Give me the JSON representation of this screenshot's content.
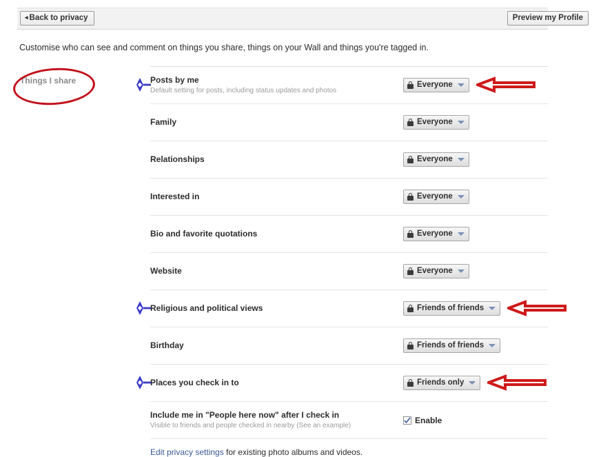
{
  "toolbar": {
    "back_label": "Back to privacy",
    "back_caret": "◂",
    "preview_label": "Preview my Profile"
  },
  "intro": {
    "text": "Customise who can see and comment on things you share, things on your Wall and things you're tagged in."
  },
  "section": {
    "label": "Things I share"
  },
  "icons": {
    "lock": "lock-icon",
    "caret_down": "chevron-down-icon",
    "checkmark": "check-icon",
    "star_marker": "blue-star-marker-icon",
    "red_arrow": "red-arrow-annotation-icon"
  },
  "colors": {
    "annotation_red": "#c2101b",
    "annotation_blue": "#3b3bc8",
    "link_blue": "#3b5998",
    "toolbar_bg": "#f2f2f2",
    "caret_blue_gray": "#7a90b5"
  },
  "rows": [
    {
      "title": "Posts by me",
      "sub": "Default setting for posts, including status updates and photos",
      "control": "dropdown",
      "value": "Everyone",
      "marker": true,
      "arrow": true
    },
    {
      "title": "Family",
      "sub": "",
      "control": "dropdown",
      "value": "Everyone",
      "marker": false,
      "arrow": false
    },
    {
      "title": "Relationships",
      "sub": "",
      "control": "dropdown",
      "value": "Everyone",
      "marker": false,
      "arrow": false
    },
    {
      "title": "Interested in",
      "sub": "",
      "control": "dropdown",
      "value": "Everyone",
      "marker": false,
      "arrow": false
    },
    {
      "title": "Bio and favorite quotations",
      "sub": "",
      "control": "dropdown",
      "value": "Everyone",
      "marker": false,
      "arrow": false
    },
    {
      "title": "Website",
      "sub": "",
      "control": "dropdown",
      "value": "Everyone",
      "marker": false,
      "arrow": false
    },
    {
      "title": "Religious and political views",
      "sub": "",
      "control": "dropdown",
      "value": "Friends of friends",
      "marker": true,
      "arrow": true
    },
    {
      "title": "Birthday",
      "sub": "",
      "control": "dropdown",
      "value": "Friends of friends",
      "marker": false,
      "arrow": false
    },
    {
      "title": "Places you check in to",
      "sub": "",
      "control": "dropdown",
      "value": "Friends only",
      "marker": true,
      "arrow": true
    },
    {
      "title": "Include me in \"People here now\" after I check in",
      "sub": "Visible to friends and people checked in nearby",
      "sub_link": "(See an example)",
      "control": "checkbox",
      "value": "Enable",
      "checked": true,
      "marker": false,
      "arrow": false
    }
  ],
  "bottom_note": {
    "link": "Edit privacy settings",
    "rest": " for existing photo albums and videos."
  }
}
